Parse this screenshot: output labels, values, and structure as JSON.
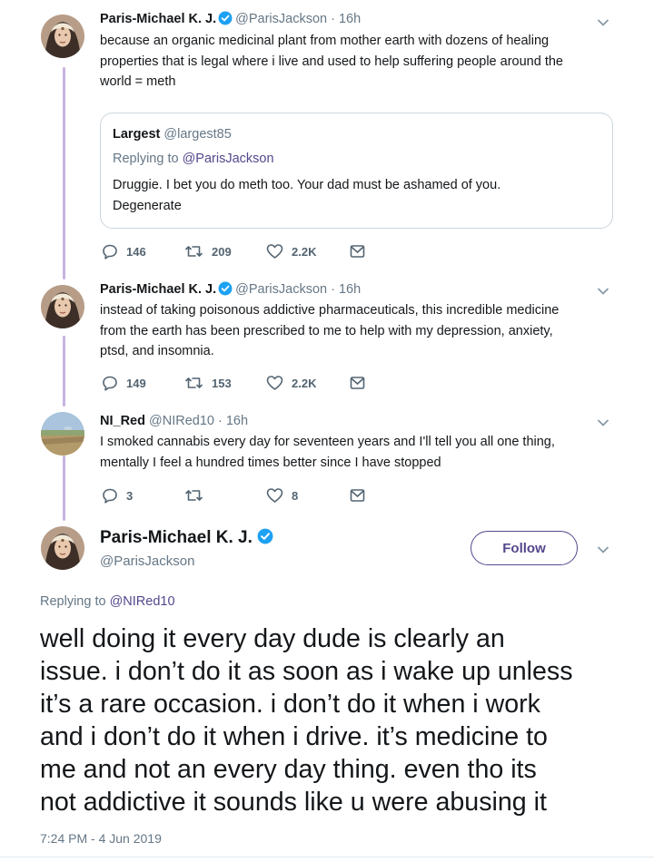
{
  "colors": {
    "accent": "#55478d",
    "verified": "#1da1f2",
    "thread_line": "#c8b3df",
    "muted": "#657786"
  },
  "tweets": [
    {
      "name": "Paris-Michael K. J.",
      "handle": "@ParisJackson · 16h",
      "lines": [
        "because an organic medicinal plant from mother earth with dozens of healing",
        "properties that is legal where i live and used to help suffering people around the",
        "world = meth"
      ],
      "quote": {
        "name": "Largest",
        "handle": "@largest85",
        "replying_prefix": "Replying to ",
        "replying_to": "@ParisJackson",
        "lines": [
          "Druggie. I bet you do meth too. Your dad must be ashamed of you.",
          "Degenerate"
        ]
      },
      "replies": "146",
      "retweets": "209",
      "likes": "2.2K"
    },
    {
      "name": "Paris-Michael K. J.",
      "handle": "@ParisJackson · 16h",
      "lines": [
        "instead of taking poisonous addictive pharmaceuticals, this incredible medicine",
        "from the earth has been prescribed to me to help with my depression, anxiety,",
        "ptsd, and insomnia."
      ],
      "replies": "149",
      "retweets": "153",
      "likes": "2.2K"
    },
    {
      "name": "NI_Red",
      "handle": "@NIRed10 · 16h",
      "lines": [
        "I smoked cannabis every day for seventeen years and I'll tell you all one thing,",
        "mentally I feel a hundred times better since I have stopped"
      ],
      "replies": "3",
      "retweets": "",
      "likes": "8"
    }
  ],
  "main_tweet": {
    "name": "Paris-Michael K. J.",
    "handle": "@ParisJackson",
    "follow_label": "Follow",
    "replying_prefix": "Replying to ",
    "replying_to": "@NIRed10",
    "lines": [
      "well doing it every day dude is clearly an",
      "issue. i don’t do it as soon as i wake up unless",
      "it’s a rare occasion. i don’t do it when i work",
      "and i don’t do it when i drive. it’s medicine to",
      "me and not an every day thing. even tho its",
      "not addictive it sounds like u were abusing it"
    ],
    "timestamp": "7:24 PM - 4 Jun 2019"
  },
  "icons": {
    "reply": "reply-icon",
    "retweet": "retweet-icon",
    "like": "heart-icon",
    "dm": "envelope-icon",
    "more": "chevron-down-icon",
    "verified": "verified-badge-icon"
  }
}
